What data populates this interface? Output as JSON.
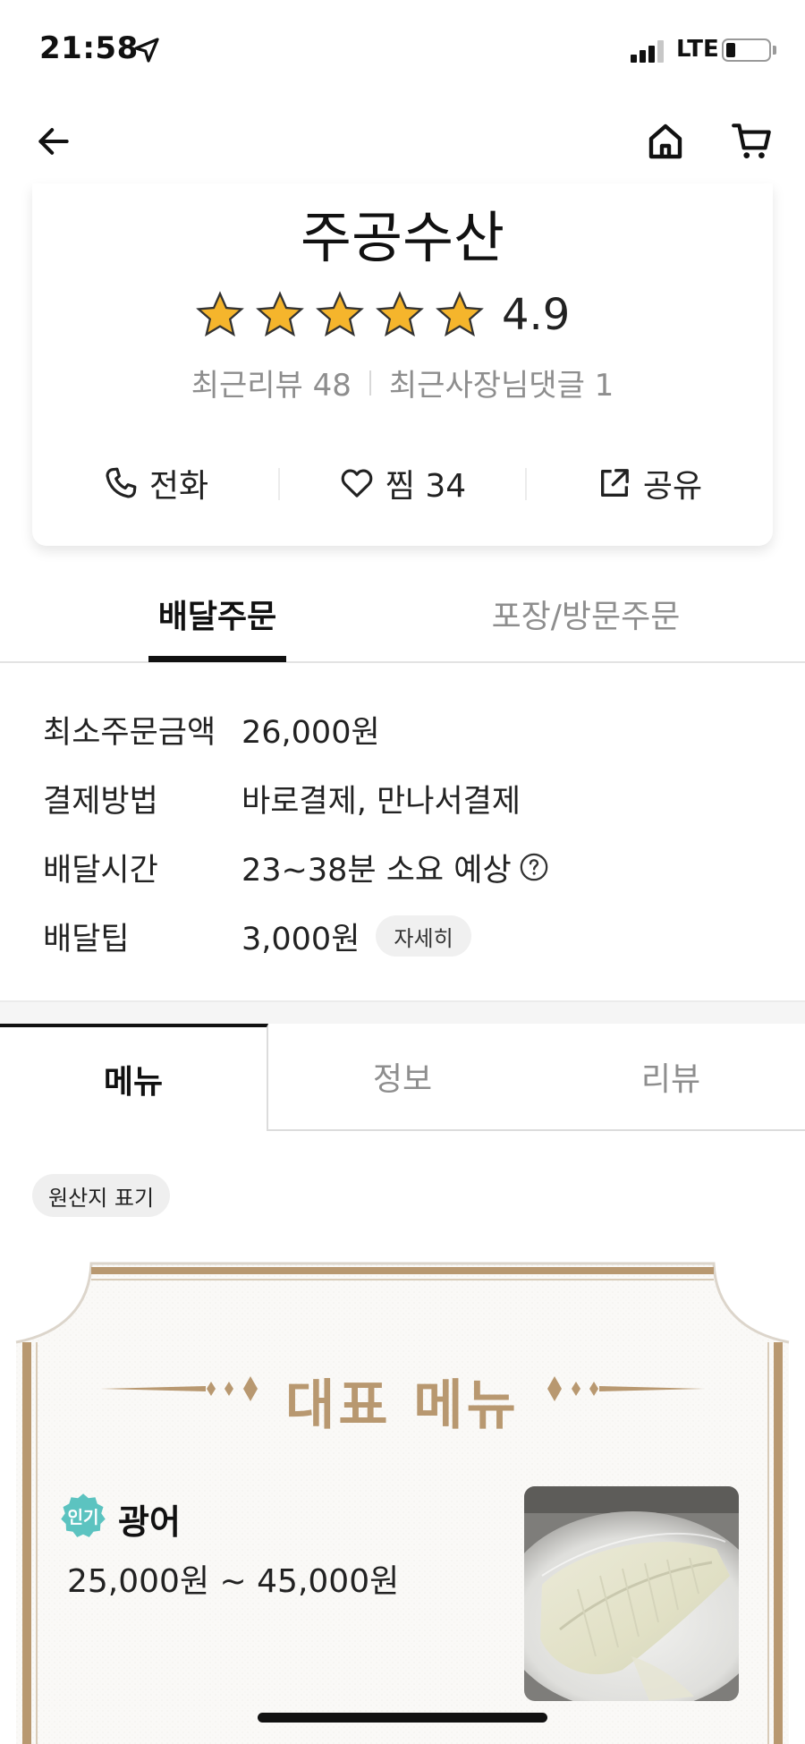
{
  "status_bar": {
    "time": "21:58",
    "network": "LTE"
  },
  "store": {
    "name": "주공수산",
    "rating": "4.9",
    "stars": 5,
    "recent_reviews": "최근리뷰 48",
    "owner_replies": "최근사장님댓글 1"
  },
  "actions": {
    "call": "전화",
    "favorite": "찜 34",
    "share": "공유"
  },
  "order_tabs": {
    "delivery": "배달주문",
    "pickup": "포장/방문주문"
  },
  "info": [
    {
      "label": "최소주문금액",
      "value": "26,000원"
    },
    {
      "label": "결제방법",
      "value": "바로결제, 만나서결제"
    },
    {
      "label": "배달시간",
      "value": "23~38분 소요 예상"
    },
    {
      "label": "배달팁",
      "value": "3,000원",
      "chip": "자세히"
    }
  ],
  "menu_tabs": {
    "menu": "메뉴",
    "info": "정보",
    "review": "리뷰"
  },
  "origin_label": "원산지 표기",
  "featured": {
    "title": "대표 메뉴",
    "item": {
      "badge": "인기",
      "name": "광어",
      "price": "25,000원 ~ 45,000원"
    }
  },
  "colors": {
    "accent_gold": "#b89870",
    "star": "#f5b52c",
    "badge_teal": "#5cc3c0"
  }
}
